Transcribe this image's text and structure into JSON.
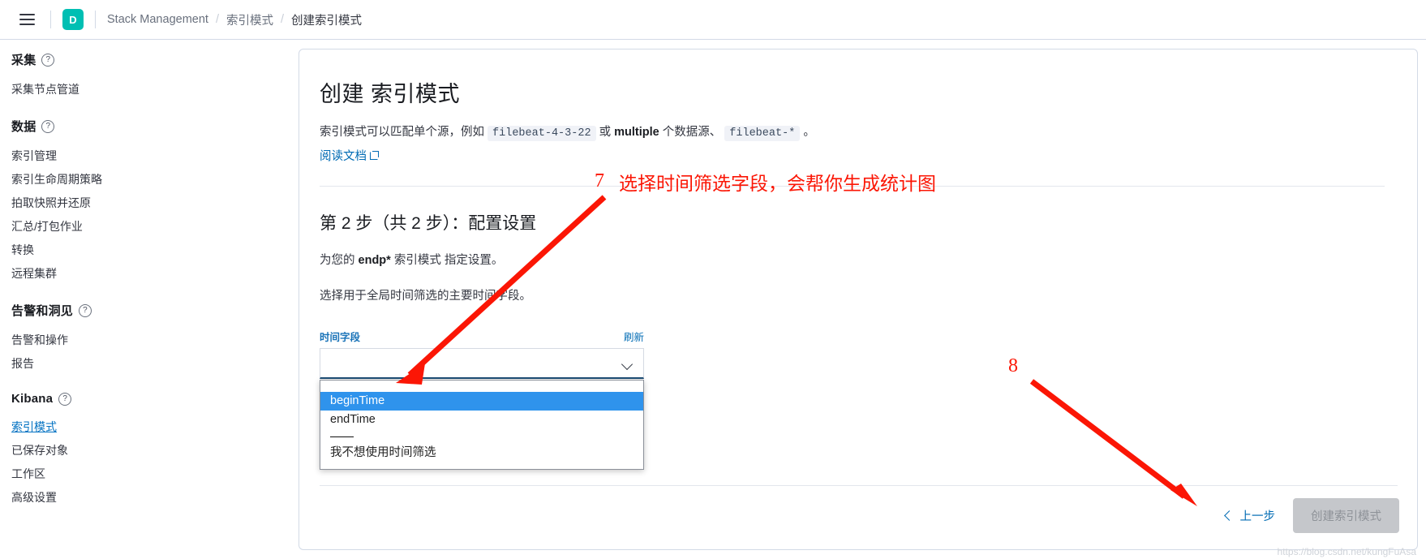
{
  "header": {
    "menu_icon": "hamburger-icon",
    "space_initial": "D",
    "breadcrumbs": [
      {
        "label": "Stack Management"
      },
      {
        "label": "索引模式"
      },
      {
        "label": "创建索引模式"
      }
    ],
    "separator": "/"
  },
  "sidebar": {
    "groups": [
      {
        "title": "采集",
        "help": "?",
        "items": [
          {
            "label": "采集节点管道",
            "active": false
          }
        ]
      },
      {
        "title": "数据",
        "help": "?",
        "items": [
          {
            "label": "索引管理",
            "active": false
          },
          {
            "label": "索引生命周期策略",
            "active": false
          },
          {
            "label": "拍取快照并还原",
            "active": false
          },
          {
            "label": "汇总/打包作业",
            "active": false
          },
          {
            "label": "转换",
            "active": false
          },
          {
            "label": "远程集群",
            "active": false
          }
        ]
      },
      {
        "title": "告警和洞见",
        "help": "?",
        "items": [
          {
            "label": "告警和操作",
            "active": false
          },
          {
            "label": "报告",
            "active": false
          }
        ]
      },
      {
        "title": "Kibana",
        "help": "?",
        "items": [
          {
            "label": "索引模式",
            "active": true
          },
          {
            "label": "已保存对象",
            "active": false
          },
          {
            "label": "工作区",
            "active": false
          },
          {
            "label": "高级设置",
            "active": false
          }
        ]
      }
    ]
  },
  "main": {
    "title": "创建 索引模式",
    "intro": {
      "part1": "索引模式可以匹配单个源，例如",
      "code1": "filebeat-4-3-22",
      "part2": "或",
      "bold1": "multiple",
      "part3": "个数据源、",
      "code2": "filebeat-*",
      "part4": "。"
    },
    "docs_link": "阅读文档",
    "step_title": "第 2 步（共 2 步）：配置设置",
    "desc_prefix": "为您的",
    "desc_pattern": "endp*",
    "desc_suffix": "索引模式 指定设置。",
    "desc_line2": "选择用于全局时间筛选的主要时间字段。",
    "time_field_label": "时间字段",
    "refresh_label": "刷新",
    "select": {
      "value": "",
      "options": [
        {
          "label": "beginTime",
          "selected": true
        },
        {
          "label": "endTime",
          "selected": false
        },
        {
          "label": "我不想使用时间筛选",
          "selected": false
        }
      ]
    },
    "prev_button": "上一步",
    "create_button": "创建索引模式"
  },
  "annotations": [
    {
      "number": "7",
      "text": "选择时间筛选字段，会帮你生成统计图"
    },
    {
      "number": "8",
      "text": ""
    }
  ],
  "watermark": "https://blog.csdn.net/kungFuAsa",
  "colors": {
    "accent_blue": "#006bb4",
    "brand_teal": "#00bfb3",
    "annotation_red": "#fb1605",
    "option_highlight": "#2f93ec"
  }
}
